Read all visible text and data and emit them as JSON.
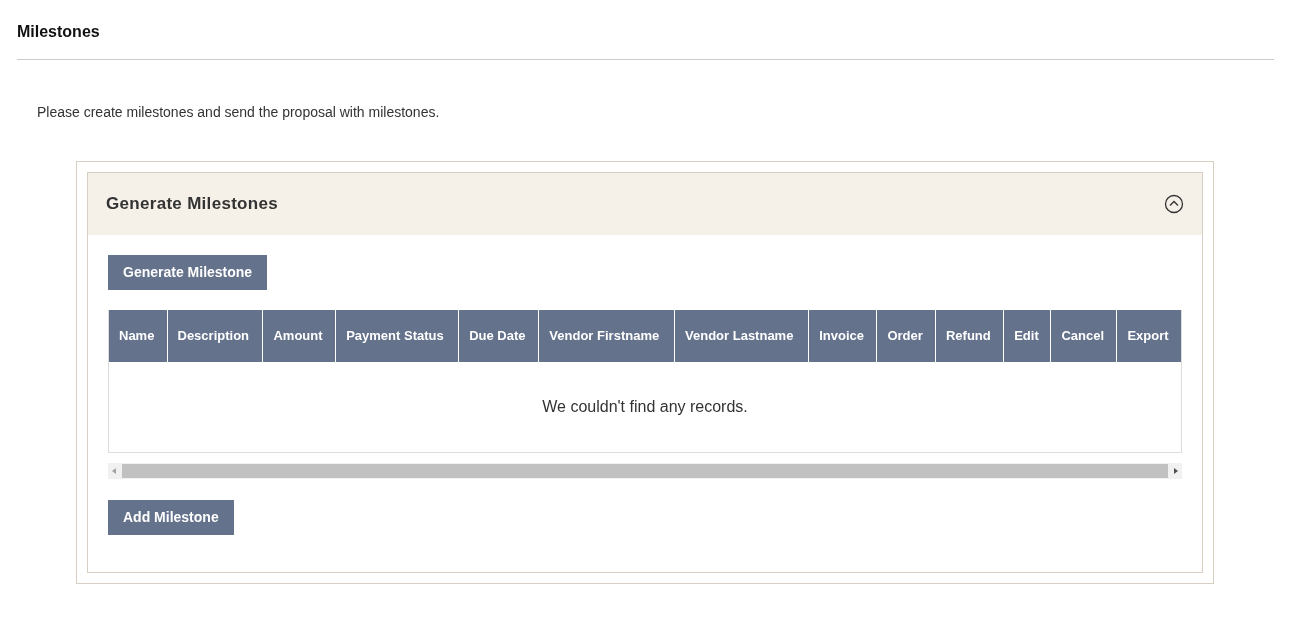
{
  "page_title": "Milestones",
  "intro": "Please create milestones and send the proposal with milestones.",
  "panel": {
    "title": "Generate Milestones",
    "expanded": true,
    "generate_button": "Generate Milestone",
    "table": {
      "columns": [
        "Name",
        "Description",
        "Amount",
        "Payment Status",
        "Due Date",
        "Vendor Firstname",
        "Vendor Lastname",
        "Invoice",
        "Order",
        "Refund",
        "Edit",
        "Cancel",
        "Export"
      ],
      "empty_message": "We couldn't find any records."
    },
    "add_button": "Add Milestone"
  }
}
